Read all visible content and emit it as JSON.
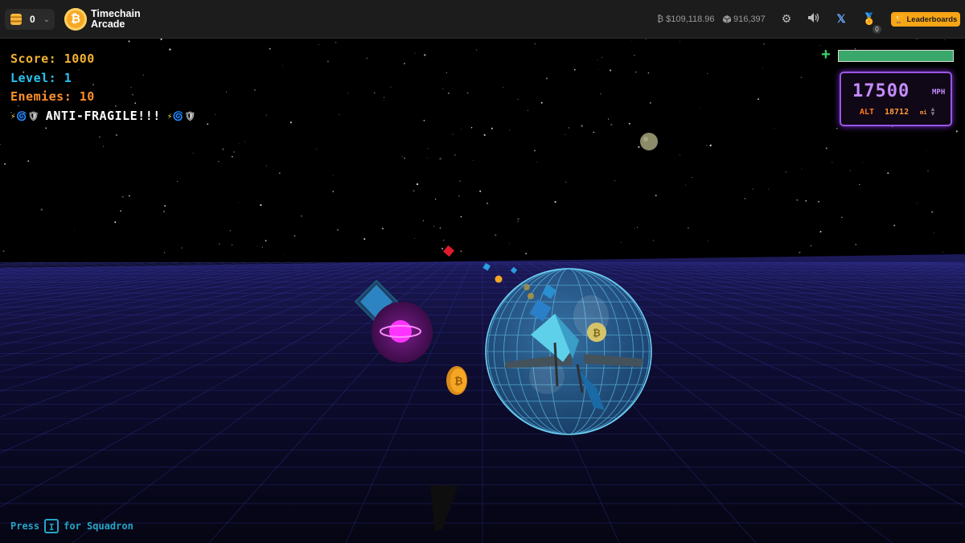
{
  "header": {
    "coin_count": "0",
    "brand_line1": "Timechain",
    "brand_line2": "Arcade",
    "logo_symbol": "₿",
    "btc_price": "$109,118.96",
    "block_height": "916,397",
    "notification_count": "0",
    "leaderboards_label": "Leaderboards",
    "icons": [
      "coin-stack-icon",
      "chevron-down-icon",
      "bitcoin-logo-icon",
      "bitcoin-icon",
      "cube-icon",
      "gear-icon",
      "speaker-icon",
      "x-logo-icon",
      "medal-icon",
      "trophy-icon"
    ]
  },
  "hud": {
    "score_label": "Score:",
    "score_value": "1000",
    "level_label": "Level:",
    "level_value": "1",
    "enemies_label": "Enemies:",
    "enemies_value": "10",
    "banner_text": "ANTI-FRAGILE!!!",
    "health_fraction": 1.0,
    "speed_value": "17500",
    "speed_unit": "MPH",
    "alt_label": "ALT",
    "alt_value": "18712",
    "alt_unit": "mi",
    "press_text": "Press",
    "press_key": "I",
    "press_suffix": "for Squadron"
  },
  "colors": {
    "score": "#f2b233",
    "level": "#27c3ee",
    "enemies": "#ff8f2a",
    "banner": "#ffffff",
    "accent": "#f6a516",
    "speed": "#c58cff",
    "altitude": "#ff9a3a",
    "grid": "#3b3aa8"
  },
  "coin_symbol": "₿"
}
